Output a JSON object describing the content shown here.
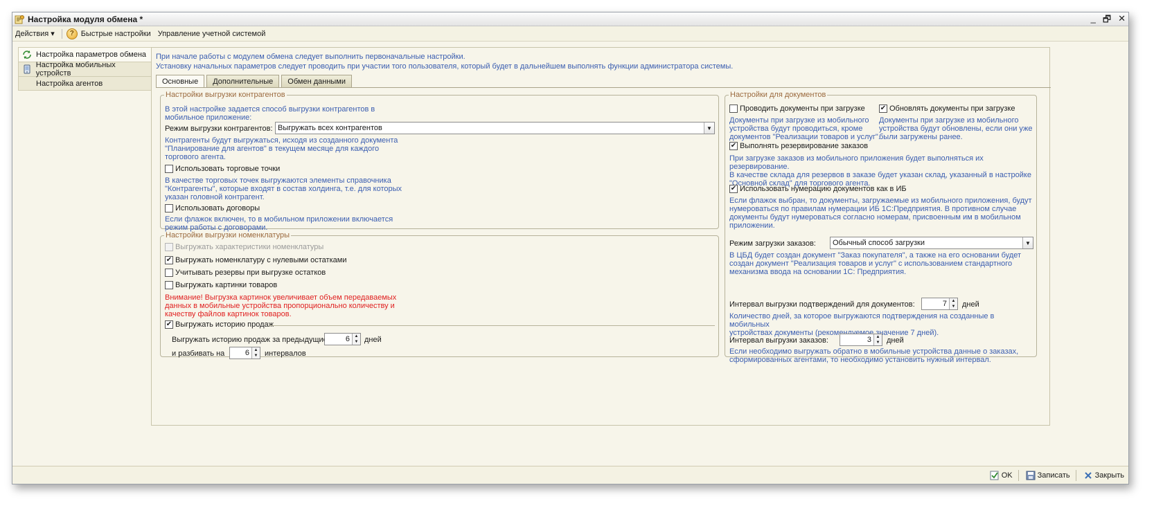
{
  "window": {
    "title": "Настройка модуля обмена *",
    "controls": [
      "_",
      "🗗",
      "✕"
    ]
  },
  "menu": {
    "actions": "Действия",
    "actions_arrow": "▾",
    "help_icon": "?",
    "quick_settings": "Быстрые настройки",
    "accounting": "Управление учетной системой"
  },
  "nav": {
    "items": [
      {
        "label": "Настройка параметров обмена",
        "icon": "refresh-icon"
      },
      {
        "label": "Настройка мобильных устройств",
        "icon": "mobile-device-icon"
      },
      {
        "label": "Настройка агентов",
        "icon": ""
      }
    ]
  },
  "intro": {
    "line1": "При начале работы с модулем обмена следует выполнить первоначальные настройки.",
    "line2": "Установку начальных параметров следует проводить при участии того пользователя, который будет в дальнейшем выполнять функции администратора системы."
  },
  "tabs": [
    "Основные",
    "Дополнительные",
    "Обмен данными"
  ],
  "contractors": {
    "legend": "Настройки выгрузки контрагентов",
    "desc1": "В этой настройке задается способ выгрузки контрагентов в",
    "desc2": "мобильное приложение:",
    "mode_label": "Режим выгрузки контрагентов:",
    "mode_value": "Выгружать всех контрагентов",
    "mode_desc1": "Контрагенты будут выгружаться, исходя из созданного документа",
    "mode_desc2": "\"Планирование для агентов\" в текущем месяце для каждого",
    "mode_desc3": "торгового агента.",
    "use_points": "Использовать торговые точки",
    "points_desc1": "В качестве торговых точек выгружаются элементы справочника",
    "points_desc2": "\"Контрагенты\", которые входят в состав холдинга, т.е. для которых",
    "points_desc3": "указан головной контрагент.",
    "use_contracts": "Использовать договоры",
    "contracts_desc1": "Если флажок включен, то в мобильном приложении включается",
    "contracts_desc2": "режим работы с договорами."
  },
  "nomenclature": {
    "legend": "Настройки выгрузки номенклатуры",
    "characteristics": "Выгружать характеристики номенклатуры",
    "zero_stock": "Выгружать номенклатуру с нулевыми остатками",
    "reserves": "Учитывать резервы при выгрузке остатков",
    "images": "Выгружать картинки товаров",
    "warning1": "Внимание! Выгрузка картинок увеличивает объем передаваемых",
    "warning2": "данных в мобильные устройства пропорционально количеству и",
    "warning3": "качеству файлов картинок товаров.",
    "history": "Выгружать историю продаж",
    "history_label": "Выгружать историю продаж за предыдущие",
    "history_days": "6",
    "days_unit": "дней",
    "split_label": "и разбивать на",
    "split_value": "6",
    "intervals_unit": "интервалов"
  },
  "documents": {
    "legend": "Настройки для документов",
    "post": "Проводить документы при загрузке",
    "post_desc1": "Документы при загрузке из мобильного",
    "post_desc2": "устройства будут проводиться, кроме",
    "post_desc3": "документов \"Реализации товаров и услуг\".",
    "update": "Обновлять документы при загрузке",
    "update_desc1": "Документы при загрузке из мобильного",
    "update_desc2": "устройства будут обновлены, если они уже",
    "update_desc3": "были загружены ранее.",
    "reserve": "Выполнять резервирование заказов",
    "reserve_desc1": "При загрузке заказов из мобильного приложения будет выполняться их резервирование.",
    "reserve_desc2": "В качестве склада для резервов в заказе будет указан склад, указанный в настройке",
    "reserve_desc3": "\"Основной склад\" для торгового агента.",
    "numbering": "Использовать нумерацию документов как в ИБ",
    "numbering_desc1": "Если флажок выбран, то документы, загружаемые из мобильного приложения, будут",
    "numbering_desc2": "нумероваться по правилам нумерации ИБ 1С:Предприятия.  В противном случае",
    "numbering_desc3": "документы будут нумероваться согласно номерам, присвоенным им в мобильном",
    "numbering_desc4": "приложении.",
    "order_mode_label": "Режим загрузки заказов:",
    "order_mode_value": "Обычный способ загрузки",
    "order_mode_desc1": "В ЦБД будет создан документ \"Заказ покупателя\", а также на его основании будет",
    "order_mode_desc2": "создан документ \"Реализация товаров и услуг\" с использованием стандартного",
    "order_mode_desc3": "механизма ввода на основании 1С: Предприятия.",
    "confirm_label": "Интервал выгрузки подтверждений для документов:",
    "confirm_value": "7",
    "days_unit": "дней",
    "confirm_desc1": "Количество дней, за которое выгружаются подтверждения на созданные в мобильных",
    "confirm_desc2": "устройствах документы (рекомендуемое значение 7 дней).",
    "orders_label": "Интервал выгрузки заказов:",
    "orders_value": "3",
    "orders_desc1": "Если необходимо выгружать обратно в мобильные устройства данные о заказах,",
    "orders_desc2": "сформированных агентами, то необходимо установить нужный интервал."
  },
  "footer": {
    "ok": "OK",
    "save": "Записать",
    "close": "Закрыть"
  },
  "colors": {
    "description": "#3a5db0",
    "warning": "#e02020",
    "legend": "#9b6a3e"
  }
}
